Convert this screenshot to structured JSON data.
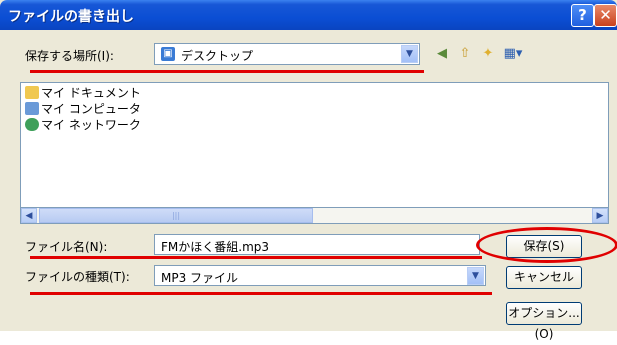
{
  "window": {
    "title": "ファイルの書き出し",
    "help_glyph": "?",
    "close_glyph": "✕"
  },
  "location": {
    "label": "保存する場所(I):",
    "value": "デスクトップ",
    "value_icon": "desktop-icon"
  },
  "toolbar": {
    "back_glyph": "◀",
    "up_glyph": "⇧",
    "new_folder_glyph": "✦",
    "views_glyph": "▦▾"
  },
  "file_list": {
    "items": [
      {
        "label": "マイ ドキュメント",
        "icon": "my-documents-icon"
      },
      {
        "label": "マイ コンピュータ",
        "icon": "my-computer-icon"
      },
      {
        "label": "マイ ネットワーク",
        "icon": "my-network-icon"
      }
    ]
  },
  "scrollbar": {
    "left_glyph": "◀",
    "right_glyph": "▶",
    "thumb_grip": "|||"
  },
  "filename": {
    "label": "ファイル名(N):",
    "value": "FMかほく番組.mp3"
  },
  "filetype": {
    "label": "ファイルの種類(T):",
    "value": "MP3 ファイル"
  },
  "buttons": {
    "save": "保存(S)",
    "cancel": "キャンセル",
    "options": "オプション... (O)"
  },
  "colors": {
    "annotation": "#e00000",
    "titlebar": "#0b4ed4"
  }
}
